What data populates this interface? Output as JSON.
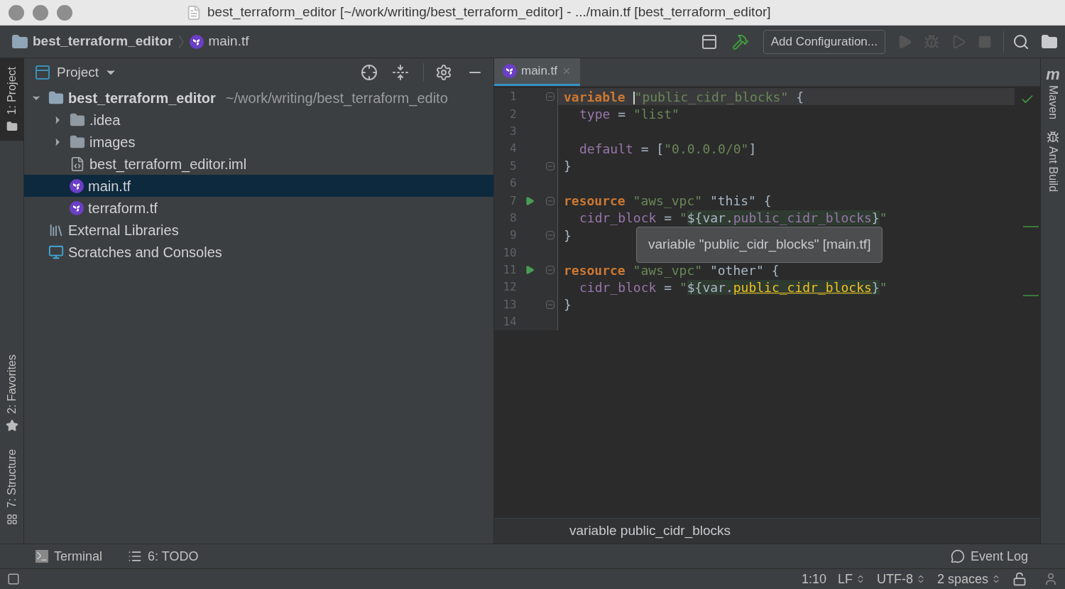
{
  "window": {
    "title": "best_terraform_editor [~/work/writing/best_terraform_editor] - .../main.tf [best_terraform_editor]"
  },
  "navbar": {
    "breadcrumbs": [
      {
        "label": "best_terraform_editor",
        "kind": "project"
      },
      {
        "label": "main.tf",
        "kind": "terraform"
      }
    ],
    "run_config": "Add Configuration..."
  },
  "left_stripe": [
    {
      "label": "1: Project",
      "selected": true,
      "kind": "project"
    },
    {
      "label": "2: Favorites",
      "selected": false,
      "kind": "star"
    },
    {
      "label": "7: Structure",
      "selected": false,
      "kind": "structure"
    }
  ],
  "right_stripe": [
    {
      "label": "Maven",
      "kind": "maven",
      "icon_text": "m"
    },
    {
      "label": "Ant Build",
      "kind": "ant"
    }
  ],
  "project_panel": {
    "title": "Project",
    "tree": [
      {
        "label": "best_terraform_editor",
        "path": "~/work/writing/best_terraform_edito",
        "kind": "module",
        "expanded": true,
        "selected": false,
        "children": [
          {
            "label": ".idea",
            "kind": "folder",
            "expanded": false,
            "selected": false
          },
          {
            "label": "images",
            "kind": "folder",
            "expanded": false,
            "selected": false
          },
          {
            "label": "best_terraform_editor.iml",
            "kind": "iml",
            "selected": false
          },
          {
            "label": "main.tf",
            "kind": "terraform",
            "selected": true
          },
          {
            "label": "terraform.tf",
            "kind": "terraform",
            "selected": false
          }
        ]
      },
      {
        "label": "External Libraries",
        "kind": "libraries",
        "selected": false
      },
      {
        "label": "Scratches and Consoles",
        "kind": "scratches",
        "selected": false
      }
    ]
  },
  "editor": {
    "tabs": [
      {
        "label": "main.tf",
        "selected": true
      }
    ],
    "lines": [
      {
        "number": "1",
        "fold": true,
        "run": false,
        "current": true,
        "indent": false,
        "tokens": [
          {
            "kind": "kw",
            "text": "variable "
          },
          {
            "kind": "caret"
          },
          {
            "kind": "str",
            "text": "\"public_cidr_blocks\""
          },
          {
            "kind": "plain",
            "text": " {"
          }
        ]
      },
      {
        "number": "2",
        "fold": false,
        "run": false,
        "current": false,
        "indent": true,
        "tokens": [
          {
            "kind": "attr",
            "text": "type"
          },
          {
            "kind": "plain",
            "text": " = "
          },
          {
            "kind": "str",
            "text": "\"list\""
          }
        ]
      },
      {
        "number": "3",
        "fold": false,
        "run": false,
        "current": false
      },
      {
        "number": "4",
        "fold": false,
        "run": false,
        "current": false,
        "indent": true,
        "tokens": [
          {
            "kind": "attr",
            "text": "default"
          },
          {
            "kind": "plain",
            "text": " = ["
          },
          {
            "kind": "str",
            "text": "\"0.0.0.0/0\""
          },
          {
            "kind": "plain",
            "text": "]"
          }
        ]
      },
      {
        "number": "5",
        "fold": true,
        "run": false,
        "current": false,
        "indent": false,
        "tokens": [
          {
            "kind": "plain",
            "text": "}"
          }
        ]
      },
      {
        "number": "6",
        "fold": false,
        "run": false,
        "current": false
      },
      {
        "number": "7",
        "fold": true,
        "run": true,
        "current": false,
        "indent": false,
        "tokens": [
          {
            "kind": "kw",
            "text": "resource "
          },
          {
            "kind": "str",
            "text": "\"aws_vpc\""
          },
          {
            "kind": "plain",
            "text": " \"this\" {"
          }
        ]
      },
      {
        "number": "8",
        "fold": false,
        "run": false,
        "current": false,
        "indent": true,
        "tokens": [
          {
            "kind": "attr",
            "text": "cidr_block"
          },
          {
            "kind": "plain",
            "text": " = "
          },
          {
            "kind": "str",
            "text": "\""
          },
          {
            "kind": "interp",
            "text": "${var."
          },
          {
            "kind": "ref",
            "text": "public_cidr_blocks"
          },
          {
            "kind": "interp",
            "text": "}"
          },
          {
            "kind": "str",
            "text": "\""
          }
        ]
      },
      {
        "number": "9",
        "fold": true,
        "run": false,
        "current": false,
        "indent": false,
        "tokens": [
          {
            "kind": "plain",
            "text": "}"
          }
        ]
      },
      {
        "number": "10",
        "fold": false,
        "run": false,
        "current": false
      },
      {
        "number": "11",
        "fold": true,
        "run": true,
        "current": false,
        "indent": false,
        "tokens": [
          {
            "kind": "kw",
            "text": "resource "
          },
          {
            "kind": "str",
            "text": "\"aws_vpc\""
          },
          {
            "kind": "plain",
            "text": " \"other\" {"
          }
        ]
      },
      {
        "number": "12",
        "fold": false,
        "run": false,
        "current": false,
        "indent": true,
        "tokens": [
          {
            "kind": "attr",
            "text": "cidr_block"
          },
          {
            "kind": "plain",
            "text": " = "
          },
          {
            "kind": "str",
            "text": "\""
          },
          {
            "kind": "interp",
            "text": "${var."
          },
          {
            "kind": "link",
            "text": "public_cidr_blocks"
          },
          {
            "kind": "interp",
            "text": "}"
          },
          {
            "kind": "str",
            "text": "\""
          }
        ]
      },
      {
        "number": "13",
        "fold": true,
        "run": false,
        "current": false,
        "indent": false,
        "tokens": [
          {
            "kind": "plain",
            "text": "}"
          }
        ]
      },
      {
        "number": "14",
        "fold": false,
        "run": false,
        "current": false
      }
    ],
    "tooltip": "variable \"public_cidr_blocks\" [main.tf]",
    "breadcrumb": "variable public_cidr_blocks"
  },
  "tool_windows": [
    {
      "label": "Terminal",
      "kind": "terminal"
    },
    {
      "label": "6: TODO",
      "kind": "todo"
    }
  ],
  "event_log": "Event Log",
  "status_bar": [
    {
      "label": "1:10",
      "kind": "text"
    },
    {
      "label": "LF",
      "kind": "select"
    },
    {
      "label": "UTF-8",
      "kind": "select"
    },
    {
      "label": "2 spaces",
      "kind": "select"
    }
  ]
}
